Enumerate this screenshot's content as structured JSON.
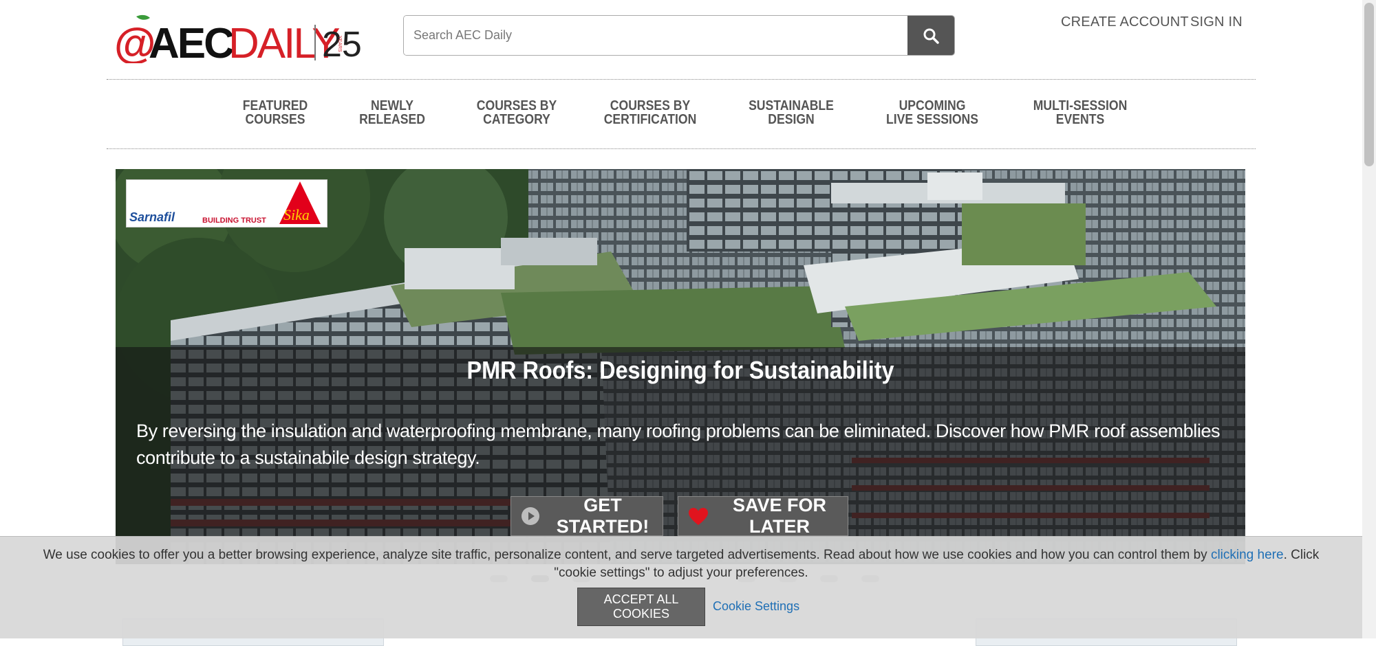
{
  "header": {
    "logo_text": "@AECDAILY",
    "logo_years": "25",
    "logo_years_label": "YEARS",
    "search_placeholder": "Search AEC Daily",
    "create_account": "CREATE ACCOUNT",
    "sign_in": "SIGN IN"
  },
  "nav": {
    "items": [
      {
        "line1": "FEATURED",
        "line2": "COURSES"
      },
      {
        "line1": "NEWLY",
        "line2": "RELEASED"
      },
      {
        "line1": "COURSES BY",
        "line2": "CATEGORY"
      },
      {
        "line1": "COURSES BY",
        "line2": "CERTIFICATION"
      },
      {
        "line1": "SUSTAINABLE",
        "line2": "DESIGN"
      },
      {
        "line1": "UPCOMING",
        "line2": "LIVE SESSIONS"
      },
      {
        "line1": "MULTI-SESSION",
        "line2": "EVENTS"
      }
    ]
  },
  "hero": {
    "sponsor_left": "Sarnafil",
    "sponsor_middle": "BUILDING TRUST",
    "sponsor_right": "Sika",
    "title": "PMR Roofs: Designing for Sustainability",
    "description": "By reversing the insulation and waterproofing membrane, many roofing problems can be eliminated. Discover how PMR roof assemblies contribute to a sustainabile design strategy.",
    "get_started": "GET STARTED!",
    "save_for_later": "SAVE FOR LATER"
  },
  "cookie": {
    "icon": "",
    "text_before": "We use cookies to offer you a better browsing experience, analyze site traffic, personalize content, and serve targeted advertisements. Read about how we use cookies and how you can control them by ",
    "link_text": "clicking here",
    "text_after": ". Click \"cookie settings\" to adjust your preferences.",
    "accept_label": "ACCEPT ALL COOKIES",
    "settings_label": "Cookie Settings"
  },
  "colors": {
    "logo_red": "#d62027",
    "nav_text": "#555555",
    "link_blue": "#1f6fb5",
    "button_gray": "#5a5a5a"
  }
}
